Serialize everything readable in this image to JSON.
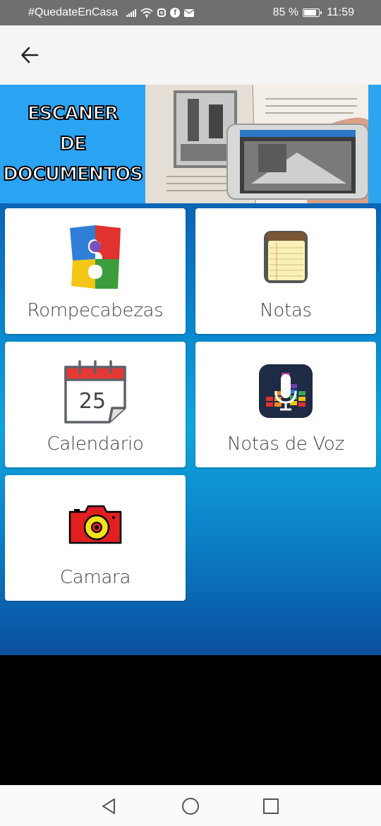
{
  "status_bar": {
    "hashtag": "#QuedateEnCasa",
    "battery_percent": "85 %",
    "battery_level": 0.85,
    "time": "11:59",
    "icons": [
      "signal-icon",
      "wifi-icon",
      "instagram-icon",
      "facebook-icon",
      "mail-icon",
      "battery-icon"
    ]
  },
  "app_bar": {
    "back_icon": "arrow-left-icon"
  },
  "banner": {
    "lines": [
      "ESCANER",
      "DE",
      "DOCUMENTOS"
    ],
    "background_color": "#2aa3f2"
  },
  "tiles": [
    {
      "label": "Rompecabezas",
      "icon": "puzzle-icon"
    },
    {
      "label": "Notas",
      "icon": "notepad-icon"
    },
    {
      "label": "Calendario",
      "icon": "calendar-icon",
      "icon_text": "25"
    },
    {
      "label": "Notas de Voz",
      "icon": "microphone-icon"
    },
    {
      "label": "Camara",
      "icon": "camera-icon"
    }
  ],
  "nav_bar": {
    "icons": [
      "back-triangle-icon",
      "home-circle-icon",
      "recents-square-icon"
    ]
  },
  "colors": {
    "status_bar": "#6f6f6f",
    "app_bar": "#f5f5f5",
    "gradient_top": "#0a4f9e",
    "gradient_mid": "#11a6de"
  }
}
